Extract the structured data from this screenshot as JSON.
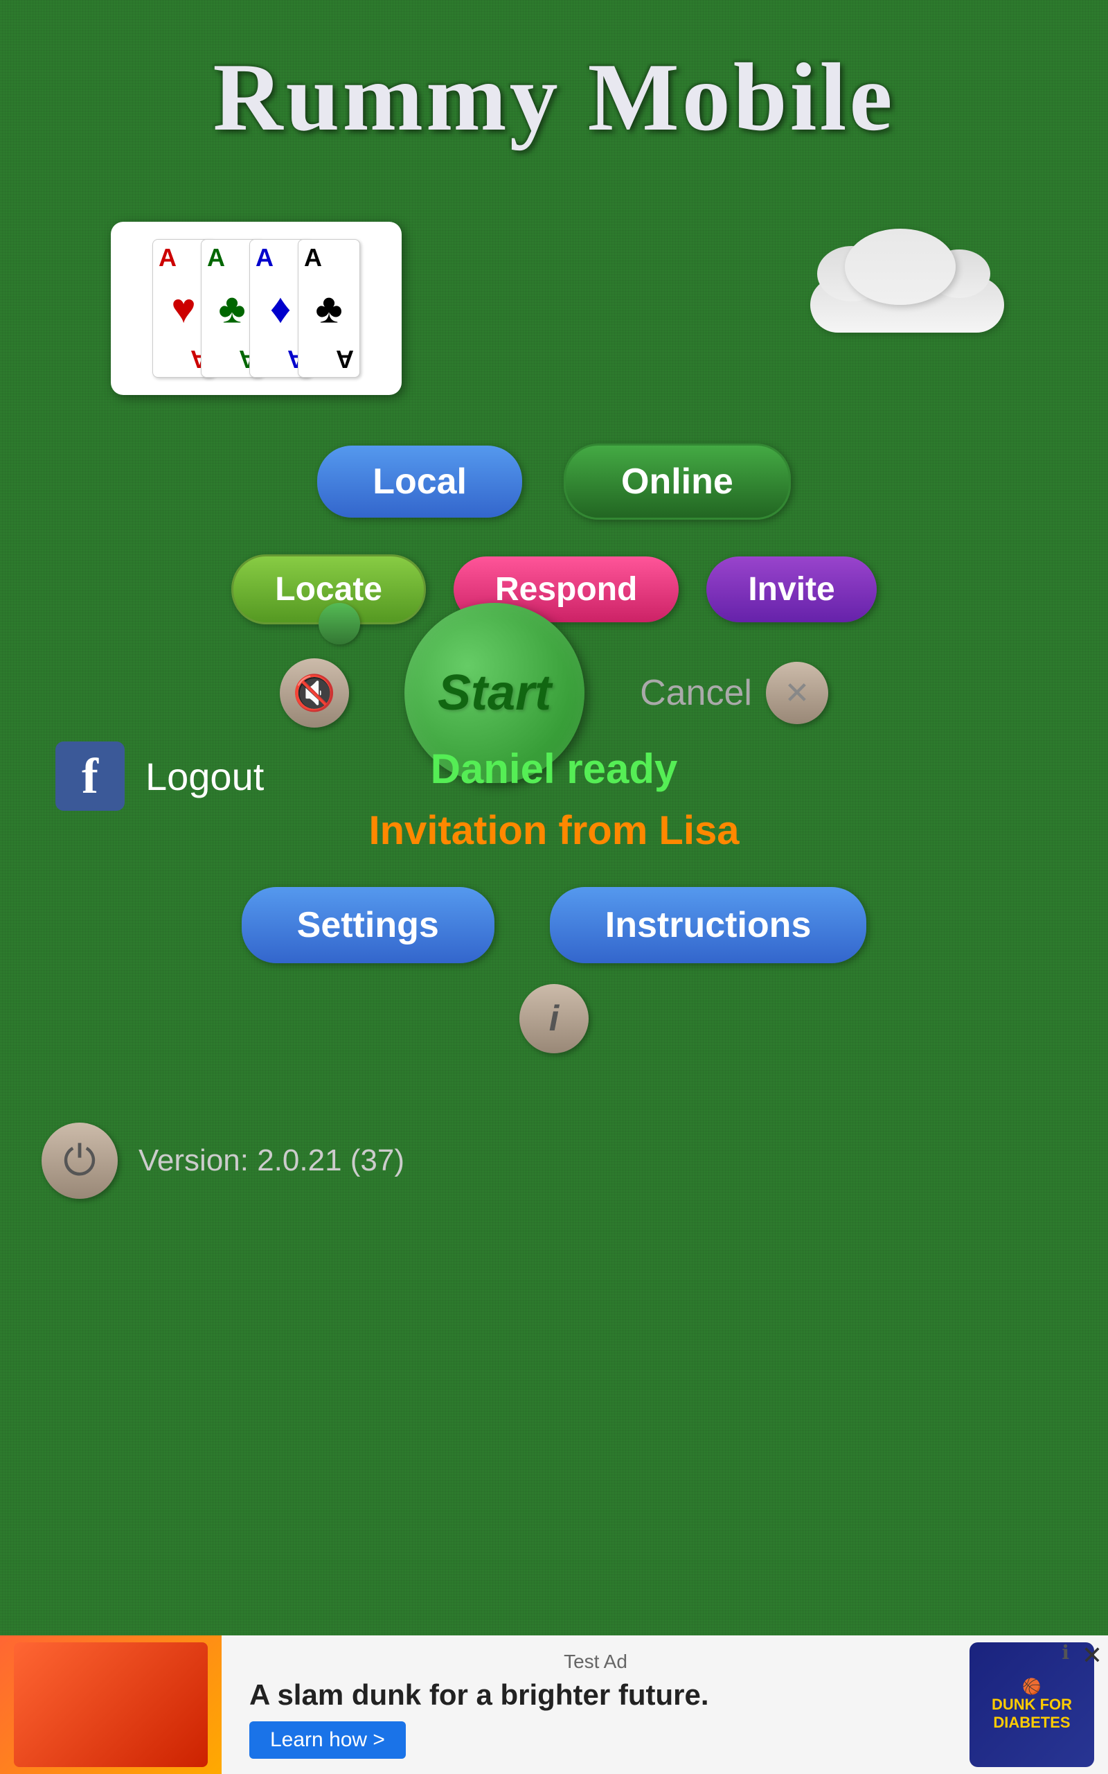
{
  "title": "Rummy Mobile",
  "cards": [
    {
      "rank": "A",
      "suit": "♥",
      "color_class": "card-red"
    },
    {
      "rank": "A",
      "suit": "♣",
      "color_class": "card-green"
    },
    {
      "rank": "A",
      "suit": "♦",
      "color_class": "card-blue"
    },
    {
      "rank": "A",
      "suit": "♣",
      "color_class": "card-black"
    }
  ],
  "buttons": {
    "local": "Local",
    "online": "Online",
    "locate": "Locate",
    "respond": "Respond",
    "invite": "Invite",
    "start": "Start",
    "cancel": "Cancel",
    "logout": "Logout",
    "settings": "Settings",
    "instructions": "Instructions"
  },
  "status": {
    "daniel_ready": "Daniel ready",
    "invitation": "Invitation from Lisa"
  },
  "version": "Version: 2.0.21 (37)",
  "ad": {
    "test_label": "Test Ad",
    "headline": "A slam dunk for a brighter future.",
    "cta": "Learn how >",
    "logo_text": "DUNK FOR\nDIABETES"
  }
}
